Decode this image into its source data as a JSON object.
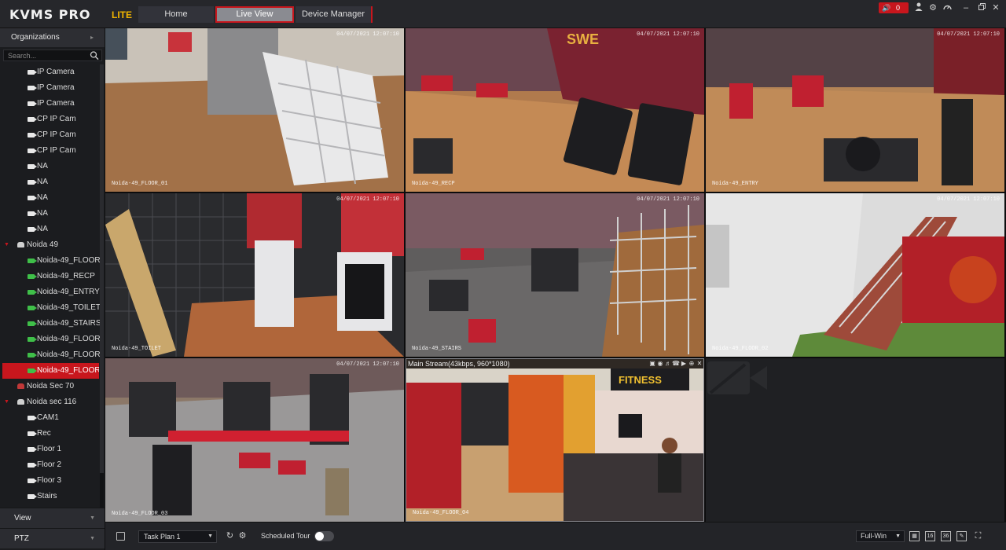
{
  "app": {
    "logo": "KVMS PRO",
    "logo_sub": "LITE",
    "tabs": [
      {
        "label": "Home"
      },
      {
        "label": "Live View"
      },
      {
        "label": "Device Manager"
      }
    ],
    "alarm_count": "0",
    "accent": "#c8161d"
  },
  "sidebar": {
    "header": "Organizations",
    "search_placeholder": "Search...",
    "tree": [
      {
        "label": "IP Camera",
        "type": "camera"
      },
      {
        "label": "IP Camera",
        "type": "camera"
      },
      {
        "label": "IP Camera",
        "type": "camera"
      },
      {
        "label": "CP IP Cam",
        "type": "camera"
      },
      {
        "label": "CP IP Cam",
        "type": "camera"
      },
      {
        "label": "CP IP Cam",
        "type": "camera"
      },
      {
        "label": "NA",
        "type": "camera"
      },
      {
        "label": "NA",
        "type": "camera"
      },
      {
        "label": "NA",
        "type": "camera"
      },
      {
        "label": "NA",
        "type": "camera"
      },
      {
        "label": "NA",
        "type": "camera"
      },
      {
        "label": "Noida 49",
        "type": "nvr"
      },
      {
        "label": "Noida-49_FLOOR_",
        "type": "camera-online"
      },
      {
        "label": "Noida-49_RECP",
        "type": "camera-online"
      },
      {
        "label": "Noida-49_ENTRY",
        "type": "camera-online"
      },
      {
        "label": "Noida-49_TOILET",
        "type": "camera-online"
      },
      {
        "label": "Noida-49_STAIRS",
        "type": "camera-online"
      },
      {
        "label": "Noida-49_FLOOR_",
        "type": "camera-online"
      },
      {
        "label": "Noida-49_FLOOR_",
        "type": "camera-online"
      },
      {
        "label": "Noida-49_FLOOR_",
        "type": "camera-online",
        "selected": true
      },
      {
        "label": "Noida Sec 70",
        "type": "nvr-offline"
      },
      {
        "label": "Noida sec 116",
        "type": "nvr"
      },
      {
        "label": "CAM1",
        "type": "camera"
      },
      {
        "label": "Rec",
        "type": "camera"
      },
      {
        "label": "Floor 1",
        "type": "camera"
      },
      {
        "label": "Floor 2",
        "type": "camera"
      },
      {
        "label": "Floor 3",
        "type": "camera"
      },
      {
        "label": "Stairs",
        "type": "camera"
      }
    ],
    "view_label": "View",
    "ptz_label": "PTZ"
  },
  "grid": {
    "tiles": [
      {
        "osd_name": "Noida-49_FLOOR_01",
        "osd_time": "04/07/2021 12:07:10"
      },
      {
        "osd_name": "Noida-49_RECP",
        "osd_time": "04/07/2021 12:07:10"
      },
      {
        "osd_name": "Noida-49_ENTRY",
        "osd_time": "04/07/2021 12:07:10"
      },
      {
        "osd_name": "Noida-49_TOILET",
        "osd_time": "04/07/2021 12:07:10"
      },
      {
        "osd_name": "Noida-49_STAIRS",
        "osd_time": "04/07/2021 12:07:10"
      },
      {
        "osd_name": "Noida-49_FLOOR_02",
        "osd_time": "04/07/2021 12:07:10"
      },
      {
        "osd_name": "Noida-49_FLOOR_03",
        "osd_time": "04/07/2021 12:07:10"
      },
      {
        "osd_name": "Noida-49_FLOOR_04",
        "osd_time": "",
        "stream_info": "Main Stream(43kbps, 960*1080)"
      }
    ]
  },
  "bottom": {
    "task_plan": "Task Plan 1",
    "scheduled_tour_label": "Scheduled Tour",
    "window_mode": "Full-Win",
    "layout_16": "16",
    "layout_36": "36"
  }
}
